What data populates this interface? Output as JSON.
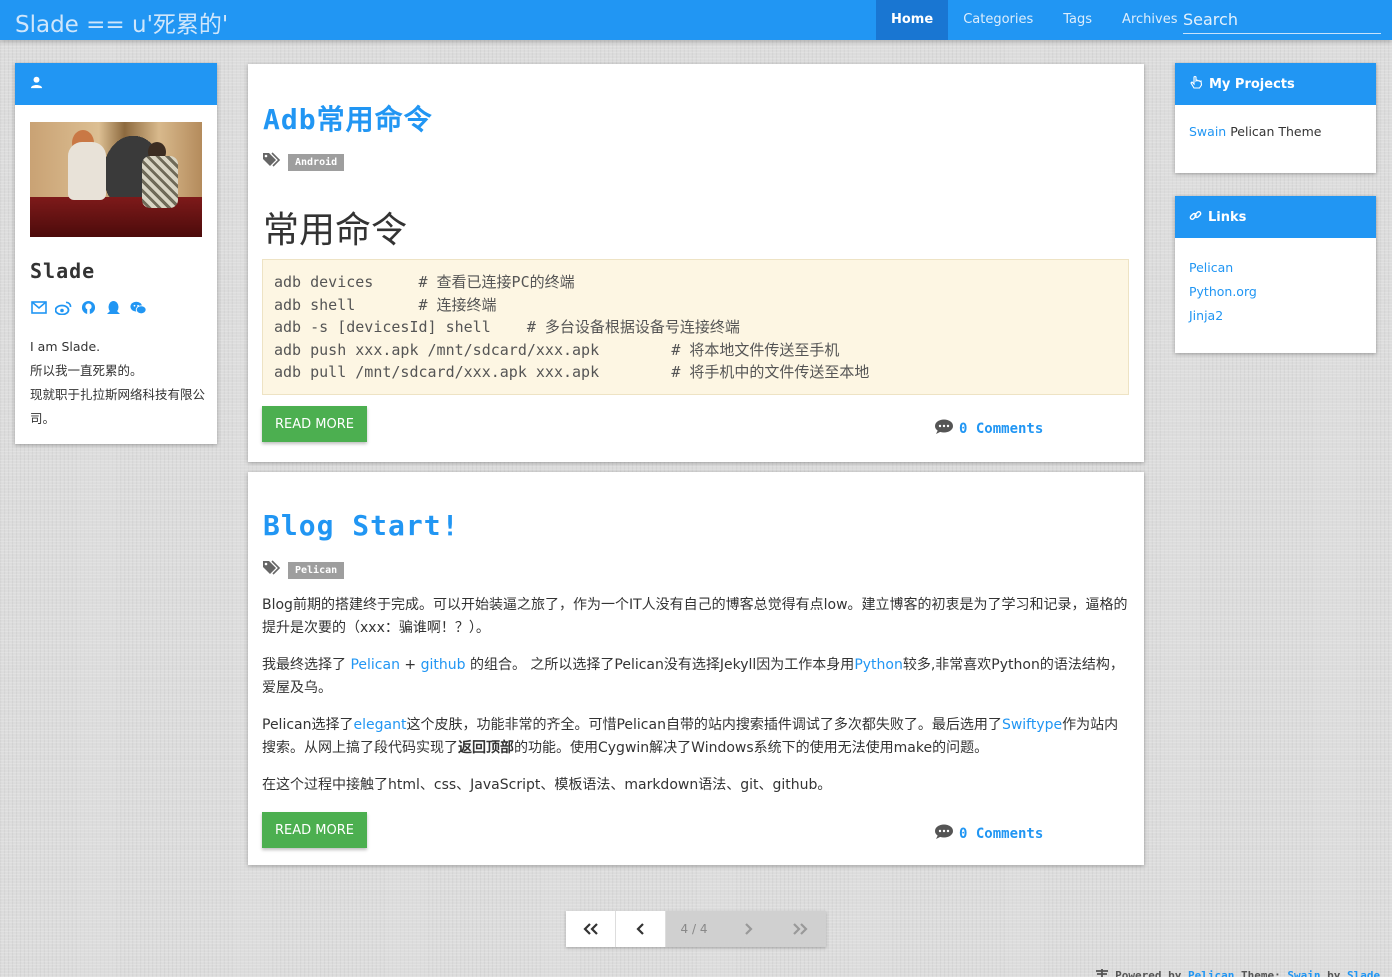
{
  "navbar": {
    "brand": "Slade == u'死累的'",
    "items": [
      {
        "label": "Home"
      },
      {
        "label": "Categories"
      },
      {
        "label": "Tags"
      },
      {
        "label": "Archives"
      }
    ],
    "search_placeholder": "Search"
  },
  "profile": {
    "name": "Slade",
    "social_icons": [
      "envelope-icon",
      "weibo-icon",
      "github-icon",
      "qq-icon",
      "wechat-icon"
    ],
    "bio": [
      "I am Slade.",
      "所以我一直死累的。",
      "现就职于扎拉斯网络科技有限公司。"
    ]
  },
  "projects": {
    "title": "My Projects",
    "items": [
      {
        "link": "Swain",
        "rest": " Pelican Theme"
      }
    ]
  },
  "links": {
    "title": "Links",
    "items": [
      "Pelican",
      "Python.org",
      "Jinja2"
    ]
  },
  "posts": [
    {
      "title": "Adb常用命令",
      "tag": "Android",
      "heading": "常用命令",
      "code": [
        "adb devices     # 查看已连接PC的终端",
        "adb shell       # 连接终端",
        "adb -s [devicesId] shell    # 多台设备根据设备号连接终端",
        "adb push xxx.apk /mnt/sdcard/xxx.apk        # 将本地文件传送至手机",
        "adb pull /mnt/sdcard/xxx.apk xxx.apk        # 将手机中的文件传送至本地"
      ],
      "read_more": "READ MORE",
      "comments": "0 Comments"
    },
    {
      "title": "Blog Start!",
      "tag": "Pelican",
      "paragraphs": {
        "p1": "Blog前期的搭建终于完成。可以开始装逼之旅了，作为一个IT人没有自己的博客总觉得有点low。建立博客的初衷是为了学习和记录，逼格的提升是次要的（xxx：骗谁啊！？）。",
        "p2a": "我最终选择了 ",
        "p2_pelican": "Pelican",
        "p2b": " + ",
        "p2_github": "github",
        "p2c": " 的组合。 之所以选择了Pelican没有选择Jekyll因为工作本身用",
        "p2_python": "Python",
        "p2d": "较多,非常喜欢Python的语法结构，爱屋及乌。",
        "p3a": "Pelican选择了",
        "p3_elegant": "elegant",
        "p3b": "这个皮肤，功能非常的齐全。可惜Pelican自带的站内搜索插件调试了多次都失败了。最后选用了",
        "p3_swiftype": "Swiftype",
        "p3c": "作为站内搜索。从网上搞了段代码实现了",
        "p3_bold": "返回顶部",
        "p3d": "的功能。使用Cygwin解决了Windows系统下的使用无法使用make的问题。",
        "p4": "在这个过程中接触了html、css、JavaScript、模板语法、markdown语法、git、github。"
      },
      "read_more": "READ MORE",
      "comments": "0 Comments"
    }
  ],
  "pagination": {
    "first": "<<",
    "prev": "<",
    "current": "4 / 4",
    "next": ">",
    "last": ">>"
  },
  "footer": {
    "powered": " Powered by ",
    "pelican": "Pelican",
    "theme": ".Theme: ",
    "swain": "Swain",
    "by": " by ",
    "slade": "Slade",
    "dot": "."
  },
  "colors": {
    "primary": "#2196f3",
    "nav_active": "#1976d2",
    "button_green": "#4caf50",
    "tag_gray": "#9e9e9e",
    "code_bg": "#fdf6e3"
  }
}
